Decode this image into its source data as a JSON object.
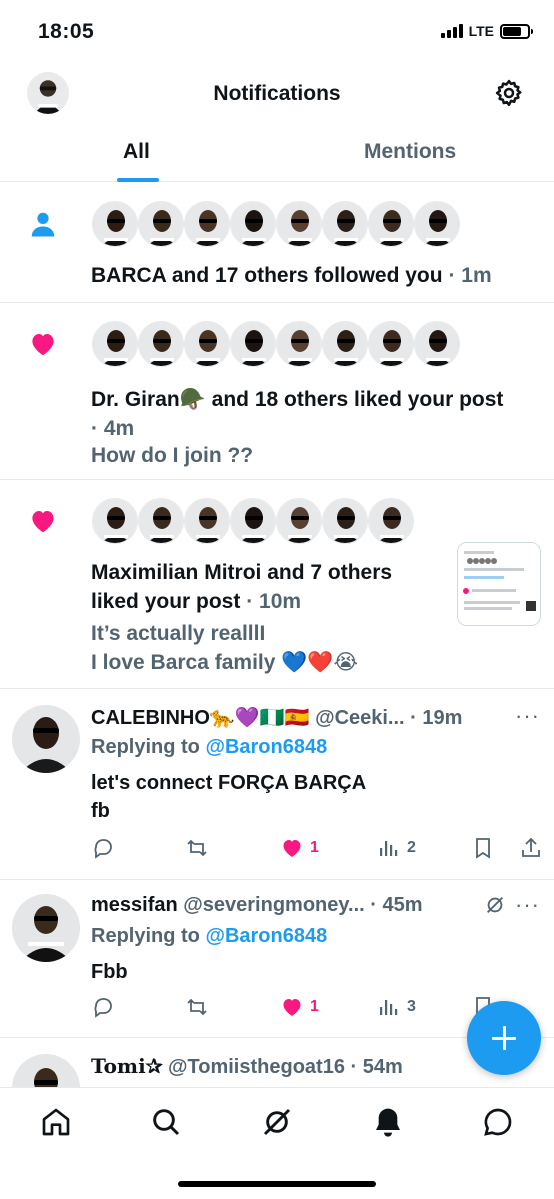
{
  "status_bar": {
    "time": "18:05",
    "network": "LTE",
    "battery_level": 0.75
  },
  "header": {
    "title": "Notifications",
    "avatar_icon": "profile-avatar",
    "settings_icon": "gear-icon"
  },
  "tabs": [
    {
      "label": "All",
      "selected": true
    },
    {
      "label": "Mentions",
      "selected": false
    }
  ],
  "notifications": [
    {
      "type": "follow",
      "icon": "person-icon",
      "avatar_count": 8,
      "text": "BARCA and 17 others followed you",
      "time": "· 1m"
    },
    {
      "type": "like",
      "icon": "heart-icon",
      "avatar_count": 8,
      "text": "Dr. Giran🪖 and 18 others liked your post",
      "time": "· 4m",
      "post_text": "How do I join ??"
    },
    {
      "type": "like",
      "icon": "heart-icon",
      "avatar_count": 7,
      "text_line1": "Maximilian Mitroi and 7 others",
      "text_line2": "liked your post",
      "time": "· 10m",
      "post_line1": "It’s actually realllI",
      "post_line2": "I love Barca family 💙❤️😭"
    }
  ],
  "tweets": [
    {
      "name": "CALEBINHO🐆💜🇳🇬🇪🇸",
      "handle": "@Ceeki...",
      "time": "· 19m",
      "replying_prefix": "Replying to",
      "replying_to": "@Baron6848",
      "body_line1": "let's connect FORÇA BARÇA",
      "body_line2": "fb",
      "likes": "1",
      "views": "2",
      "liked": true
    },
    {
      "name": "messifan",
      "handle": "@severingmoney...",
      "time": "· 45m",
      "replying_prefix": "Replying to",
      "replying_to": "@Baron6848",
      "body_line1": "Fbb",
      "likes": "1",
      "views": "3",
      "liked": true
    },
    {
      "name": "Tomi✰",
      "handle": "@Tomiisthegoat16",
      "time": "· 54m"
    }
  ],
  "more_label": "···",
  "colors": {
    "accent": "#1d9bf0",
    "like": "#f91880",
    "secondary_text": "#536471",
    "border": "#e7e9ea"
  },
  "bottom_nav": [
    "home-icon",
    "search-icon",
    "grok-icon",
    "bell-icon",
    "messages-icon"
  ]
}
